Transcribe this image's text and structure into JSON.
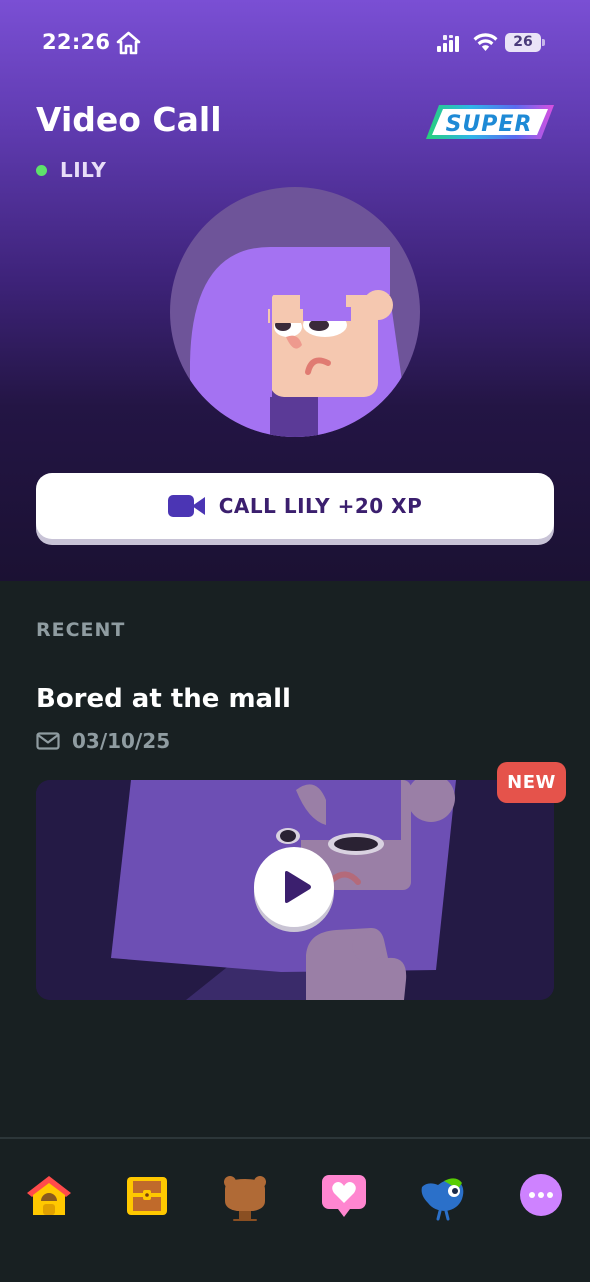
{
  "status_bar": {
    "time": "22:26",
    "battery": "26"
  },
  "header": {
    "title": "Video Call",
    "badge": "SUPER",
    "contact_name": "LILY",
    "online_color": "#5ee26b"
  },
  "call_button": {
    "label": "CALL LILY +20 XP",
    "icon": "video-camera-icon"
  },
  "recent": {
    "section_label": "RECENT",
    "items": [
      {
        "title": "Bored at the mall",
        "date": "03/10/25",
        "date_icon": "mail-icon",
        "badge": "NEW",
        "action_icon": "play-icon"
      }
    ]
  },
  "tab_bar": {
    "tabs": [
      {
        "icon": "home-icon"
      },
      {
        "icon": "treasure-chest-icon"
      },
      {
        "icon": "guidebook-icon"
      },
      {
        "icon": "heart-message-icon"
      },
      {
        "icon": "duo-bird-icon"
      },
      {
        "icon": "more-icon"
      }
    ]
  },
  "colors": {
    "accent_purple": "#3b1f6e",
    "new_badge": "#e5534b",
    "muted_text": "#8f9ca1",
    "background": "#182022"
  }
}
